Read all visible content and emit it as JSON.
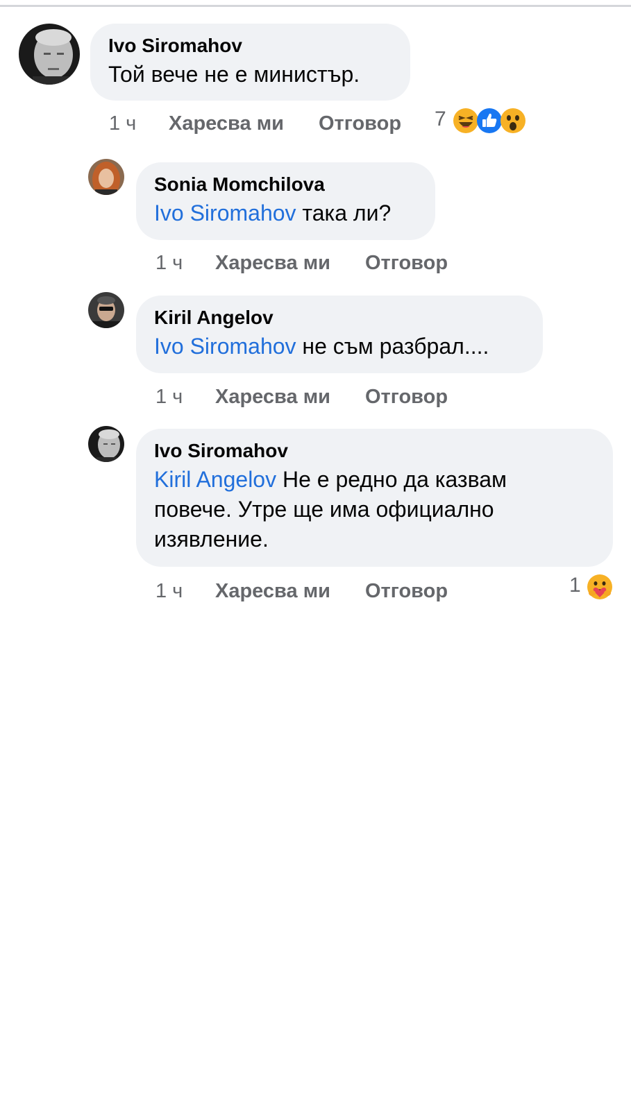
{
  "comments": [
    {
      "author": "Ivo Siromahov",
      "text": "Той вече не е министър.",
      "time": "1 ч",
      "like": "Харесва ми",
      "reply": "Отговор",
      "reaction_count": "7",
      "reactions": [
        "haha-icon",
        "like-icon",
        "wow-icon"
      ]
    },
    {
      "author": "Sonia Momchilova",
      "mention": "Ivo Siromahov",
      "text": " така ли?",
      "time": "1 ч",
      "like": "Харесва ми",
      "reply": "Отговор"
    },
    {
      "author": "Kiril Angelov",
      "mention": "Ivo Siromahov",
      "text": " не съм разбрал....",
      "time": "1 ч",
      "like": "Харесва ми",
      "reply": "Отговор"
    },
    {
      "author": "Ivo Siromahov",
      "mention": "Kiril Angelov",
      "text": " Не е редно да казвам повече. Утре ще има официално изявление.",
      "time": "1 ч",
      "like": "Харесва ми",
      "reply": "Отговор",
      "reaction_count": "1",
      "reactions": [
        "care-icon"
      ]
    }
  ],
  "colors": {
    "bubble": "#f0f2f5",
    "mention": "#216fdb",
    "meta": "#65676b",
    "like_blue": "#1877f2",
    "emoji_yellow": "#f7b125"
  }
}
